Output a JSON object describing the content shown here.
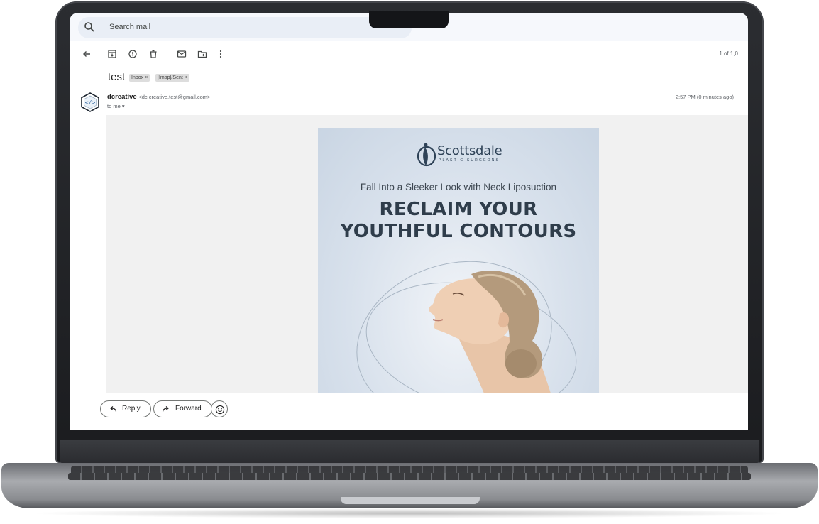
{
  "gmail": {
    "search": {
      "placeholder": "Search mail",
      "icon": "search-icon"
    },
    "toolbar": {
      "icons": [
        "back-arrow-icon",
        "archive-icon",
        "report-spam-icon",
        "delete-icon",
        "mark-unread-icon",
        "move-to-icon",
        "more-vert-icon"
      ],
      "paging": "1 of 1,0"
    },
    "message": {
      "subject": "test",
      "labels": [
        "Inbox ×",
        "[Imap]/Sent ×"
      ],
      "sender_name": "dcreative",
      "sender_email": "<dc.creative.test@gmail.com>",
      "recipient": "to me ▾",
      "timestamp": "2:57 PM (0 minutes ago)"
    },
    "email_banner": {
      "brand": "Scottsdale",
      "brand_sub": "PLASTIC SURGEONS",
      "tagline": "Fall Into a Sleeker Look with Neck Liposuction",
      "headline_line1": "RECLAIM YOUR",
      "headline_line2": "YOUTHFUL CONTOURS"
    },
    "actions": {
      "reply_label": "Reply",
      "forward_label": "Forward",
      "emoji_icon": "add-emoji-icon"
    }
  },
  "colors": {
    "brand_navy": "#2e4257",
    "banner_blue": "#c9d5e3",
    "gmail_surface": "#f6f8fc"
  }
}
